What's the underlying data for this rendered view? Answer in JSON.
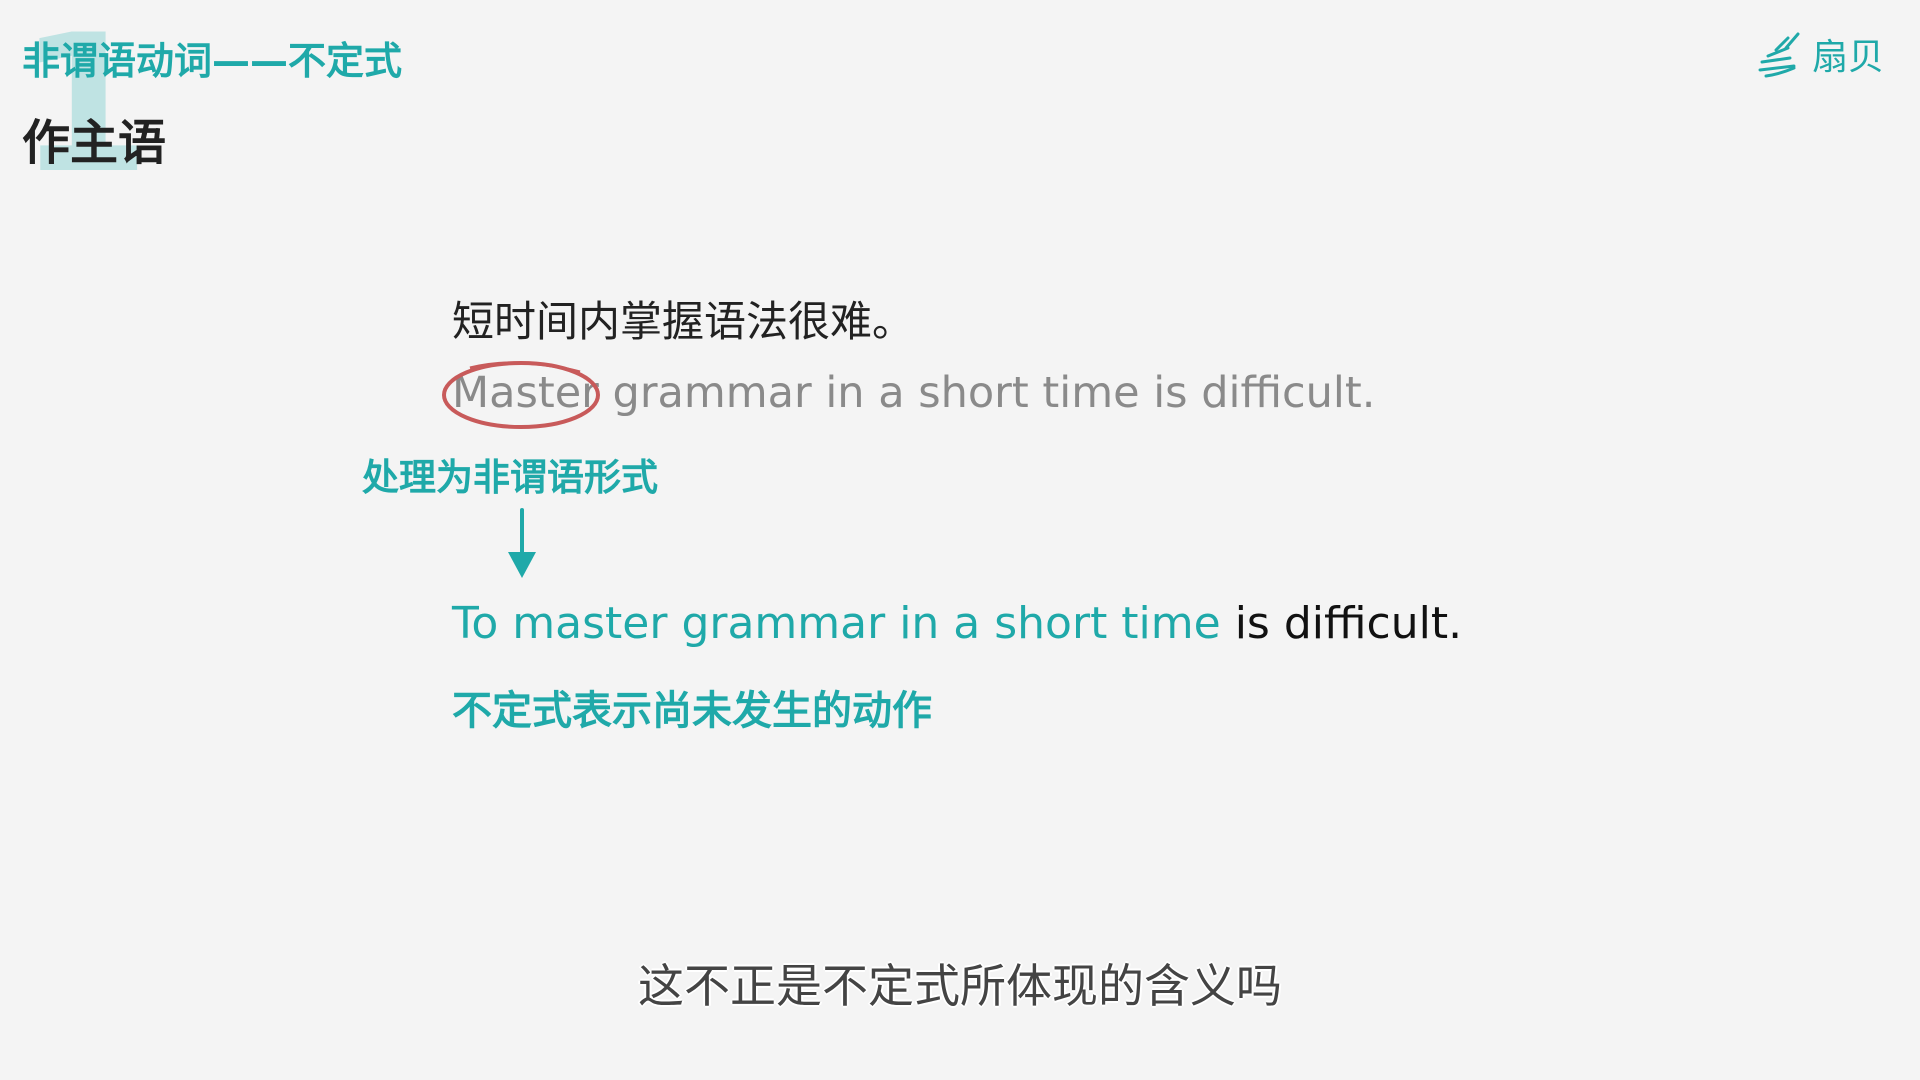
{
  "header": {
    "section_number": "1",
    "section_title": "非谓语动词——不定式",
    "sub_title": "作主语"
  },
  "logo": {
    "icon": "fan-rays-icon",
    "text": "扇贝"
  },
  "content": {
    "chinese_sentence": "短时间内掌握语法很难。",
    "english_sentence": {
      "circled_word": "Master",
      "rest": " grammar in a short time is difficult."
    },
    "note_convert": "处理为非谓语形式",
    "arrow_icon": "arrow-down-icon",
    "infinitive_sentence": {
      "highlight": "To master grammar in a short time",
      "rest": " is difficult."
    },
    "note_meaning": "不定式表示尚未发生的动作"
  },
  "subtitle_caption": "这不正是不定式所体现的含义吗",
  "colors": {
    "accent": "#1fa9a9",
    "number_tint": "#bfe3e3",
    "circle": "#c85a5a",
    "muted_text": "#8a8a8a",
    "background": "#f4f4f4"
  }
}
